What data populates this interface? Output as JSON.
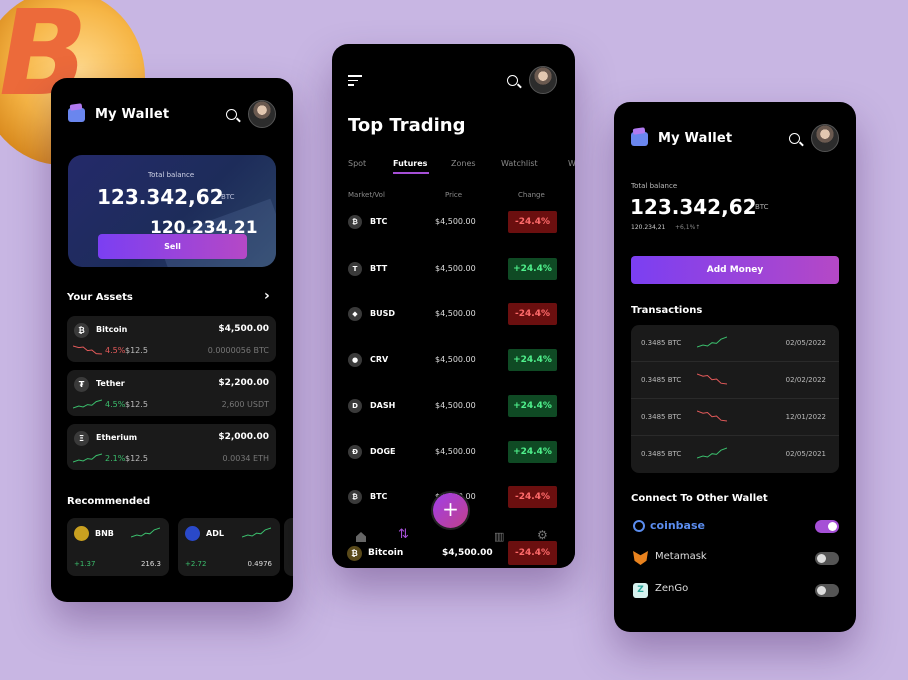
{
  "colors": {
    "background": "#c8b6e3",
    "accent_gradient_start": "#7b3ff2",
    "accent_gradient_end": "#b548c6",
    "positive": "#3bbf6d",
    "negative": "#e45a5a"
  },
  "decor": {
    "coin_symbol": "B"
  },
  "wallet1": {
    "title": "My Wallet",
    "balance_card": {
      "label": "Total balance",
      "amount": "123.342,62",
      "currency": "BTC",
      "secondary": "120.234,21",
      "sell_label": "Sell"
    },
    "assets_title": "Your Assets",
    "assets": [
      {
        "name": "Bitcoin",
        "value": "$4,500.00",
        "change": "4.5%",
        "price": "$12.5",
        "holding": "0.0000056 BTC",
        "trend": "down",
        "icon": "bitcoin-icon",
        "glyph": "₿"
      },
      {
        "name": "Tether",
        "value": "$2,200.00",
        "change": "4.5%",
        "price": "$12.5",
        "holding": "2,600 USDT",
        "trend": "up",
        "icon": "tether-icon",
        "glyph": "₮"
      },
      {
        "name": "Etherium",
        "value": "$2,000.00",
        "change": "2.1%",
        "price": "$12.5",
        "holding": "0.0034 ETH",
        "trend": "up",
        "icon": "ethereum-icon",
        "glyph": "Ξ"
      }
    ],
    "recommended_title": "Recommended",
    "recommended": [
      {
        "name": "BNB",
        "change": "+1.37",
        "value": "216.3",
        "icon": "bnb-icon"
      },
      {
        "name": "ADL",
        "change": "+2.72",
        "value": "0.4976",
        "icon": "adl-icon"
      }
    ]
  },
  "trading": {
    "title": "Top Trading",
    "tabs": [
      "Spot",
      "Futures",
      "Zones",
      "Watchlist",
      "W"
    ],
    "active_tab": "Futures",
    "columns": [
      "Market/Vol",
      "Price",
      "Change"
    ],
    "rows": [
      {
        "symbol": "BTC",
        "price": "$4,500.00",
        "change": "-24.4%",
        "dir": "down",
        "glyph": "₿"
      },
      {
        "symbol": "BTT",
        "price": "$4,500.00",
        "change": "+24.4%",
        "dir": "up",
        "glyph": "T"
      },
      {
        "symbol": "BUSD",
        "price": "$4,500.00",
        "change": "-24.4%",
        "dir": "down",
        "glyph": "◆"
      },
      {
        "symbol": "CRV",
        "price": "$4,500.00",
        "change": "+24.4%",
        "dir": "up",
        "glyph": "●"
      },
      {
        "symbol": "DASH",
        "price": "$4,500.00",
        "change": "+24.4%",
        "dir": "up",
        "glyph": "D"
      },
      {
        "symbol": "DOGE",
        "price": "$4,500.00",
        "change": "+24.4%",
        "dir": "up",
        "glyph": "Ð"
      },
      {
        "symbol": "BTC",
        "price": "$4,500.00",
        "change": "-24.4%",
        "dir": "down",
        "glyph": "₿"
      }
    ],
    "bottom": {
      "coin": "Bitcoin",
      "price": "$4,500.00",
      "change": "-24.4%"
    }
  },
  "wallet2": {
    "title": "My Wallet",
    "balance_label": "Total balance",
    "balance": "123.342,62",
    "currency": "BTC",
    "sub_value": "120.234,21",
    "sub_change": "+6,1%↑",
    "add_money_label": "Add Money",
    "transactions_title": "Transactions",
    "transactions": [
      {
        "amount": "0.3485 BTC",
        "date": "02/05/2022",
        "trend": "up"
      },
      {
        "amount": "0.3485 BTC",
        "date": "02/02/2022",
        "trend": "down"
      },
      {
        "amount": "0.3485 BTC",
        "date": "12/01/2022",
        "trend": "down"
      },
      {
        "amount": "0.3485 BTC",
        "date": "02/05/2021",
        "trend": "up"
      }
    ],
    "connect_title": "Connect To Other Wallet",
    "wallets": [
      {
        "name": "coinbase",
        "enabled": true,
        "icon": "coinbase-icon"
      },
      {
        "name": "Metamask",
        "enabled": false,
        "icon": "metamask-icon"
      },
      {
        "name": "ZenGo",
        "enabled": false,
        "icon": "zengo-icon"
      }
    ]
  }
}
